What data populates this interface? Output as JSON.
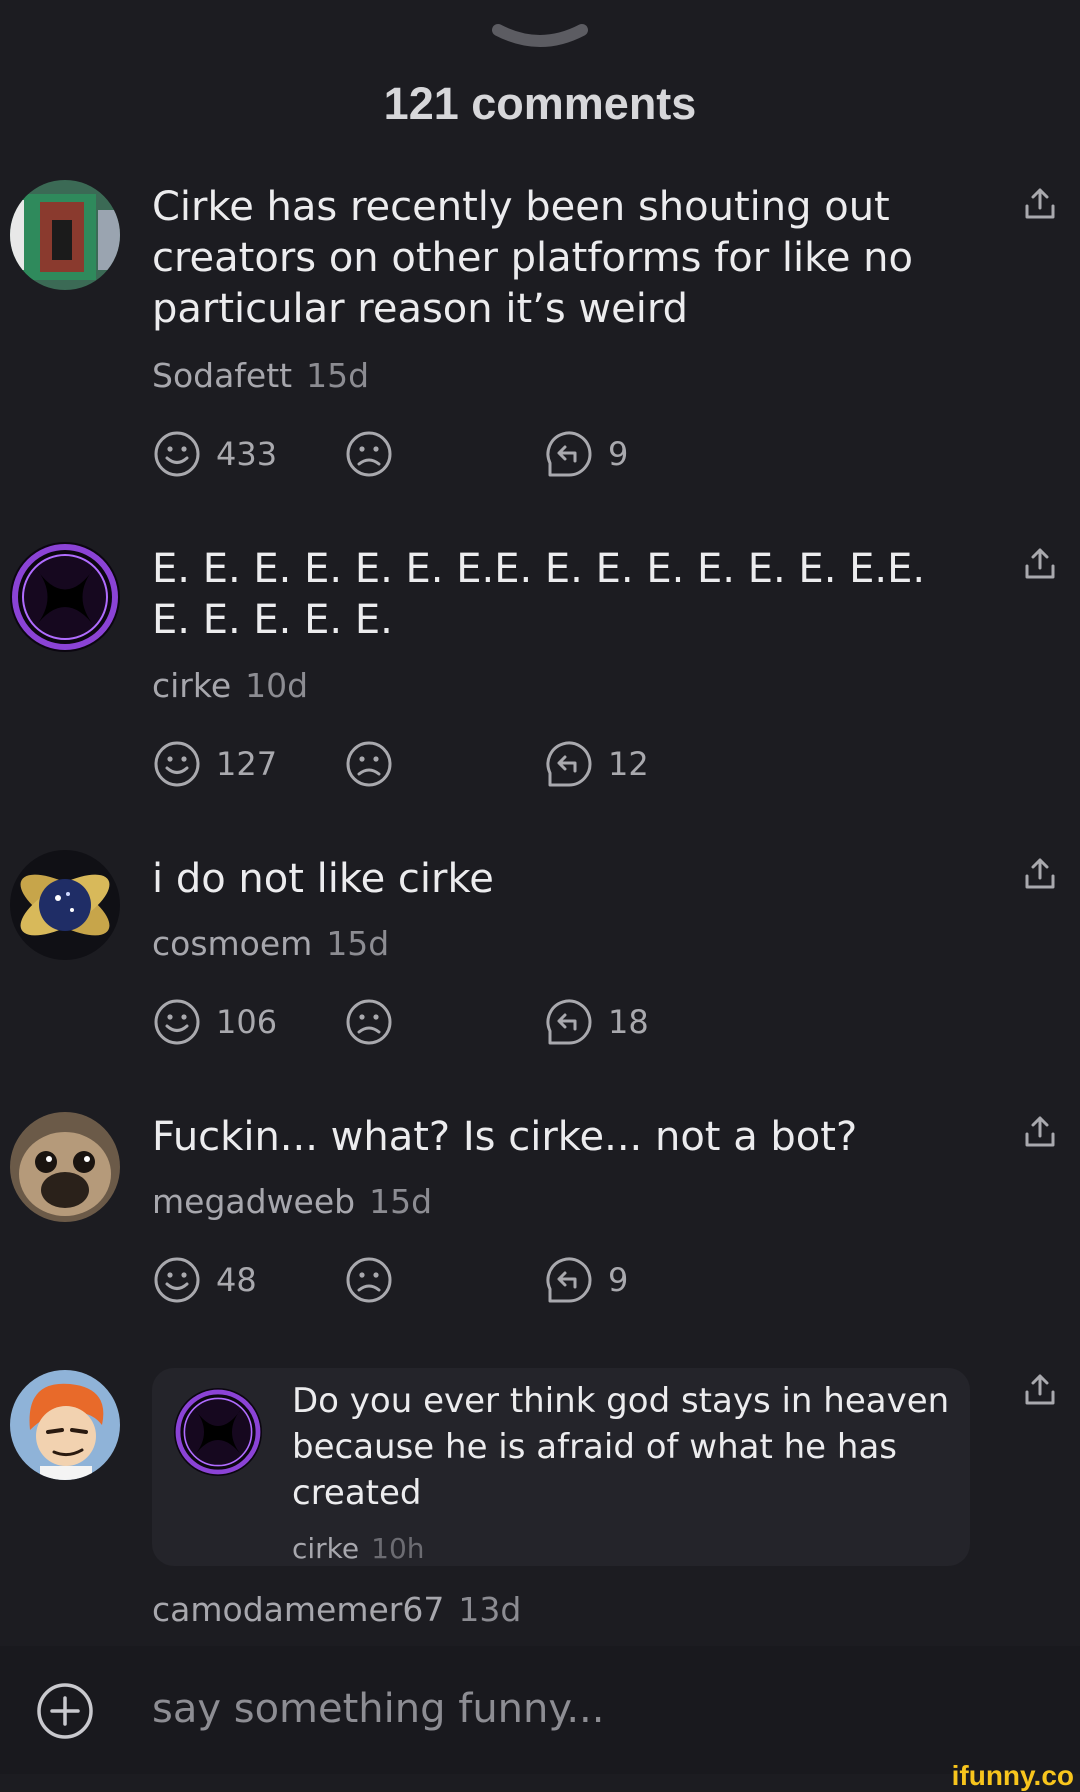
{
  "header": {
    "chevron_icon": "chevron-down-icon",
    "title": "121 comments"
  },
  "comments": [
    {
      "text": "Cirke has recently been shouting out creators on other platforms for like no particular reason it’s weird",
      "username": "Sodafett",
      "time": "15d",
      "smile_count": "433",
      "replies": "9"
    },
    {
      "text": "E. E. E. E. E. E. E.E. E. E. E. E. E. E. E.E. E. E. E. E. E.",
      "username": "cirke",
      "time": "10d",
      "smile_count": "127",
      "replies": "12"
    },
    {
      "text": "i do not like cirke",
      "username": "cosmoem",
      "time": "15d",
      "smile_count": "106",
      "replies": "18"
    },
    {
      "text": "Fuckin... what? Is cirke... not a bot?",
      "username": "megadweeb",
      "time": "15d",
      "smile_count": "48",
      "replies": "9"
    },
    {
      "username": "camodamemer67",
      "time": "13d",
      "quoted": {
        "text": "Do you ever think god stays in heaven because he is afraid of what he has created",
        "username": "cirke",
        "time": "10h"
      }
    }
  ],
  "composer": {
    "placeholder": "say something funny...",
    "add_icon": "plus-circle-icon"
  },
  "watermark": "ifunny.co",
  "colors": {
    "background": "#1c1c21",
    "composer": "#19191e",
    "watermark": "#f8c51d"
  }
}
